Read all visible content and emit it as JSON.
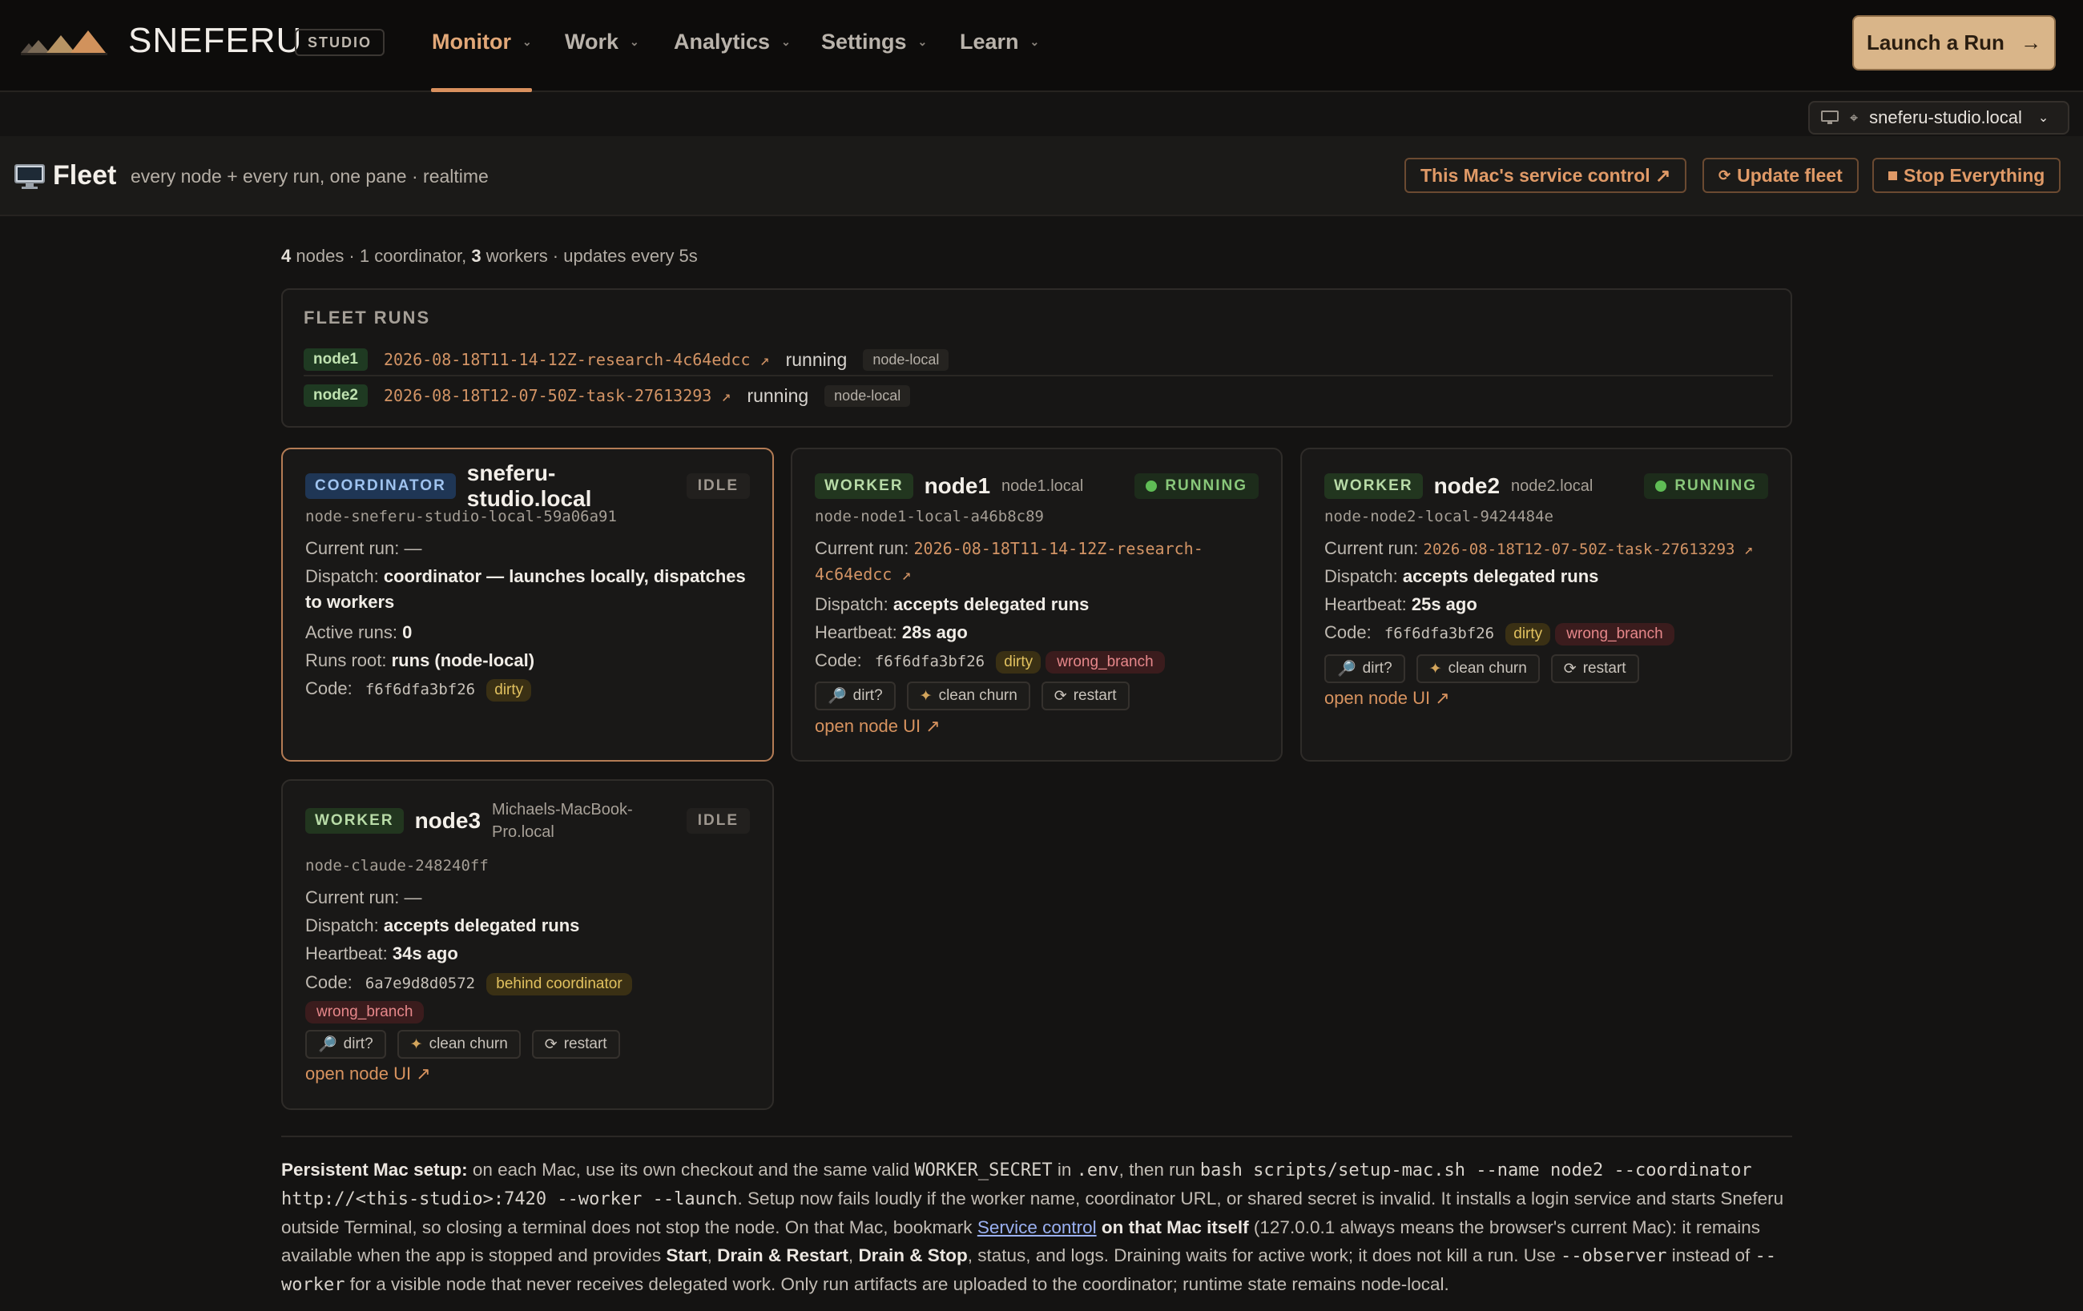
{
  "nav": {
    "brand": "SNEFERU",
    "studio_badge": "STUDIO",
    "items": [
      {
        "label": "Monitor",
        "active": true
      },
      {
        "label": "Work"
      },
      {
        "label": "Analytics"
      },
      {
        "label": "Settings"
      },
      {
        "label": "Learn"
      }
    ],
    "launch_label": "Launch a Run",
    "launch_icon": "arrow-right-icon"
  },
  "host_select": {
    "value": "sneferu-studio.local",
    "icon": "monitor-icon"
  },
  "fleet": {
    "title": "Fleet",
    "subtitle": "every node + every run, one pane · realtime",
    "buttons": {
      "service_control": "This Mac's service control ↗",
      "update_fleet": "Update fleet",
      "stop_everything": "Stop Everything"
    }
  },
  "summary": {
    "nodes_count": "4",
    "nodes_word": "nodes · 1 coordinator,",
    "workers_count": "3",
    "rest": "workers · updates every 5s"
  },
  "fleet_runs": {
    "title": "FLEET RUNS",
    "rows": [
      {
        "node": "node1",
        "run": "2026-08-18T11-14-12Z-research-4c64edcc ↗",
        "status": "running",
        "location": "node-local"
      },
      {
        "node": "node2",
        "run": "2026-08-18T12-07-50Z-task-27613293 ↗",
        "status": "running",
        "location": "node-local"
      }
    ]
  },
  "nodes": {
    "coordinator": {
      "role": "COORDINATOR",
      "name": "sneferu-studio.local",
      "state": "IDLE",
      "id": "node-sneferu-studio-local-59a06a91",
      "current_run_label": "Current run:",
      "current_run": "—",
      "dispatch_label": "Dispatch:",
      "dispatch": "coordinator — launches locally, dispatches to workers",
      "active_runs_label": "Active runs:",
      "active_runs": "0",
      "runs_root_label": "Runs root:",
      "runs_root": "runs (node-local)",
      "code_label": "Code:",
      "sha": "f6f6dfa3bf26",
      "tags": [
        "dirty"
      ]
    },
    "node1": {
      "role": "WORKER",
      "name": "node1",
      "host": "node1.local",
      "state": "RUNNING",
      "id": "node-node1-local-a46b8c89",
      "current_run_label": "Current run:",
      "current_run": "2026-08-18T11-14-12Z-research-4c64edcc ↗",
      "dispatch_label": "Dispatch:",
      "dispatch": "accepts delegated runs",
      "heartbeat_label": "Heartbeat:",
      "heartbeat": "28s ago",
      "code_label": "Code:",
      "sha": "f6f6dfa3bf26",
      "tags": [
        "dirty",
        "wrong_branch"
      ],
      "actions": [
        "dirt?",
        "clean churn",
        "restart"
      ],
      "open_ui": "open node UI ↗"
    },
    "node2": {
      "role": "WORKER",
      "name": "node2",
      "host": "node2.local",
      "state": "RUNNING",
      "id": "node-node2-local-9424484e",
      "current_run_label": "Current run:",
      "current_run": "2026-08-18T12-07-50Z-task-27613293 ↗",
      "dispatch_label": "Dispatch:",
      "dispatch": "accepts delegated runs",
      "heartbeat_label": "Heartbeat:",
      "heartbeat": "25s ago",
      "code_label": "Code:",
      "sha": "f6f6dfa3bf26",
      "tags": [
        "dirty",
        "wrong_branch"
      ],
      "actions": [
        "dirt?",
        "clean churn",
        "restart"
      ],
      "open_ui": "open node UI ↗"
    },
    "node3": {
      "role": "WORKER",
      "name": "node3",
      "host": "Michaels-MacBook-Pro.local",
      "state": "IDLE",
      "id": "node-claude-248240ff",
      "current_run_label": "Current run:",
      "current_run": "—",
      "dispatch_label": "Dispatch:",
      "dispatch": "accepts delegated runs",
      "heartbeat_label": "Heartbeat:",
      "heartbeat": "34s ago",
      "code_label": "Code:",
      "sha": "6a7e9d8d0572",
      "tags": [
        "behind coordinator",
        "wrong_branch"
      ],
      "actions": [
        "dirt?",
        "clean churn",
        "restart"
      ],
      "open_ui": "open node UI ↗"
    }
  },
  "footer": {
    "p1_bold": "Persistent Mac setup:",
    "p1a": " on each Mac, use its own checkout and the same valid ",
    "c_secret": "WORKER_SECRET",
    "p1b": " in ",
    "c_env": ".env",
    "p1c": ", then run ",
    "c_cmd": "bash scripts/setup-mac.sh --name node2 --coordinator http://<this-studio>:7420 --worker --launch",
    "p1d": ". Setup now fails loudly if the worker name, coordinator URL, or shared secret is invalid. It installs a login service and starts Sneferu outside Terminal, so closing a terminal does not stop the node. On that Mac, bookmark ",
    "link": "Service control",
    "p1e_bold": " on that Mac itself",
    "p1f": " (127.0.0.1 always means the browser's current Mac): it remains available when the app is stopped and provides ",
    "b_start": "Start",
    "sep1": ", ",
    "b_drain": "Drain & Restart",
    "sep2": ", ",
    "b_stop": "Drain & Stop",
    "p1g": ", status, and logs. Draining waits for active work; it does not kill a run. Use ",
    "c_observer": "--observer",
    "p1h": " instead of ",
    "c_worker": "--worker",
    "p1i": " for a visible node that never receives delegated work. Only run artifacts are uploaded to the coordinator; runtime state remains node-local."
  },
  "colors": {
    "accent": "#d9905e",
    "running": "#5fbd55",
    "dirty": "#e1c15f",
    "wrong_branch": "#e6878a"
  }
}
